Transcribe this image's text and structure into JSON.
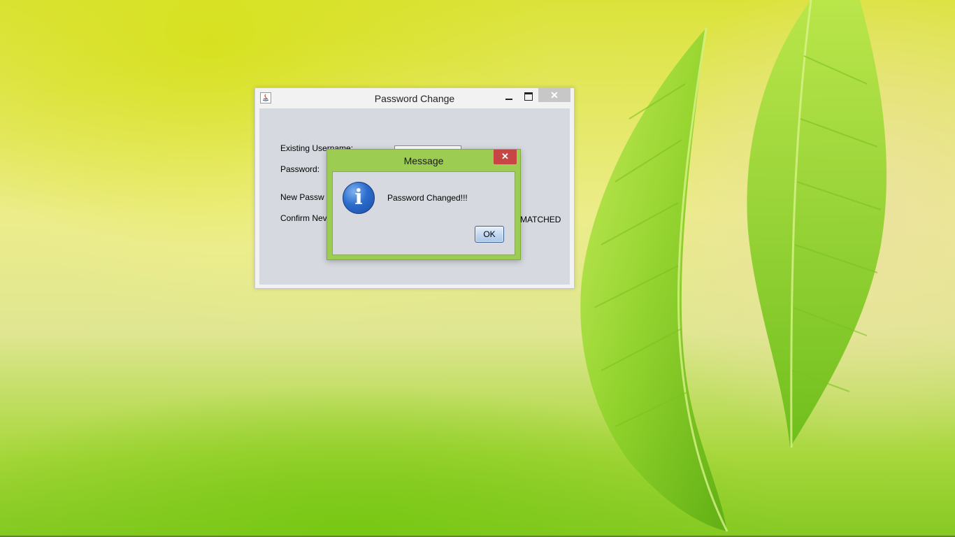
{
  "main_window": {
    "title": "Password Change",
    "close_glyph": "✕",
    "labels": {
      "username": "Existing Username:",
      "password": "Password:",
      "new_password": "New Passw",
      "confirm_new": "Confirm Nev",
      "status": "MATCHED"
    }
  },
  "message_dialog": {
    "title": "Message",
    "close_glyph": "✕",
    "icon_glyph": "i",
    "text": "Password Changed!!!",
    "ok_label": "OK"
  },
  "icons": {
    "window": "java-app-icon",
    "dialog": "info-icon"
  },
  "colors": {
    "dialog_frame": "#9ccd52",
    "dialog_close": "#c74545",
    "content_bg": "#d6d9df",
    "main_close": "#c7c7c7"
  }
}
